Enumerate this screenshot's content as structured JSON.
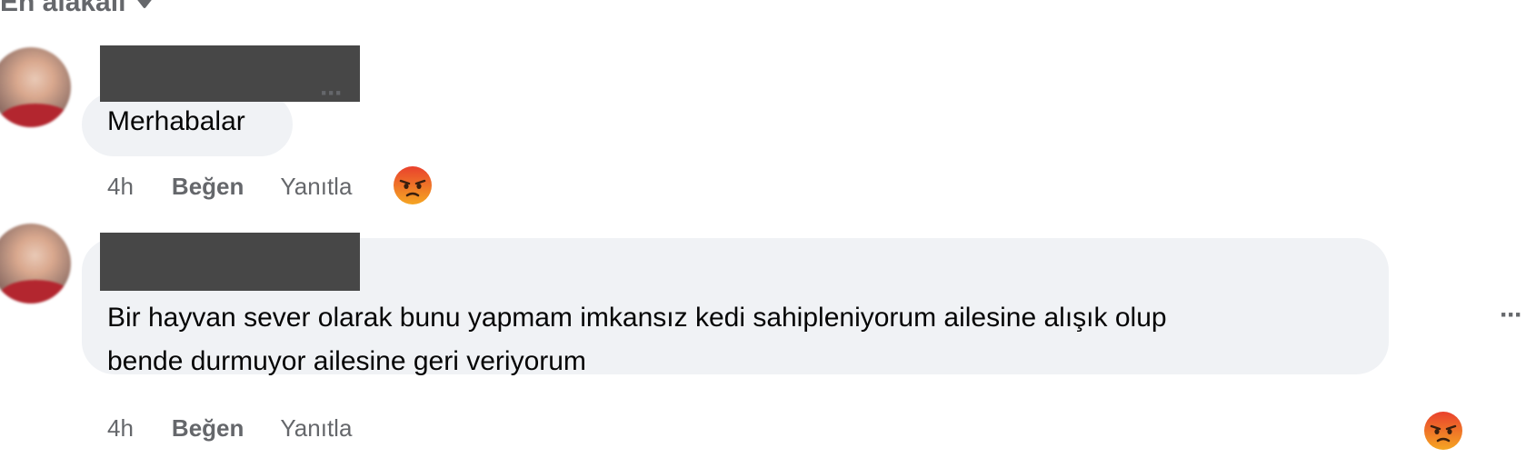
{
  "sort": {
    "label": "En alakalı"
  },
  "comments": [
    {
      "text_lines": [
        "Merhabalar"
      ],
      "time": "4h",
      "like_label": "Beğen",
      "reply_label": "Yanıtla",
      "reaction_icon": "angry-face-icon"
    },
    {
      "text_lines": [
        "Bir hayvan sever olarak bunu yapmam imkansız kedi sahipleniyorum ailesine alışık olup",
        "bende durmuyor ailesine geri veriyorum"
      ],
      "time": "4h",
      "like_label": "Beğen",
      "reply_label": "Yanıtla",
      "reaction_icon": "angry-face-icon"
    }
  ],
  "more_glyph": "···",
  "colors": {
    "bubble": "#f0f2f5",
    "secondary_text": "#65676b",
    "redaction": "#474747",
    "angry_top": "#f5a623",
    "angry_bottom": "#e9412d"
  }
}
